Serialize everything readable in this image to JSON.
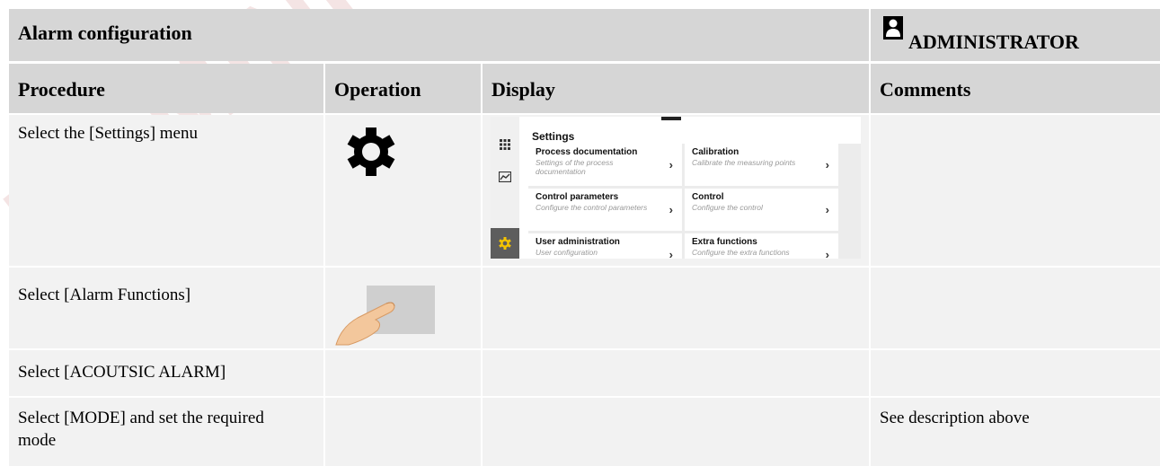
{
  "header": {
    "title": "Alarm configuration",
    "role": "ADMINISTRATOR"
  },
  "columns": [
    "Procedure",
    "Operation",
    "Display",
    "Comments"
  ],
  "rows": [
    {
      "procedure": "Select the [Settings] menu",
      "operation_icon": "gear-icon",
      "comment": ""
    },
    {
      "procedure": "Select [Alarm Functions]",
      "operation_icon": "finger-tap-icon",
      "comment": ""
    },
    {
      "procedure": "Select [ACOUTSIC ALARM]",
      "comment": ""
    },
    {
      "procedure": "Select [MODE] and set the required mode",
      "comment": "See description above"
    }
  ],
  "settings_screen": {
    "title": "Settings",
    "sidebar": [
      "apps-icon",
      "chart-icon",
      "gear-icon"
    ],
    "tiles": [
      {
        "title": "Process documentation",
        "subtitle": "Settings of the process documentation"
      },
      {
        "title": "Calibration",
        "subtitle": "Calibrate the measuring points"
      },
      {
        "title": "Control parameters",
        "subtitle": "Configure the control parameters"
      },
      {
        "title": "Control",
        "subtitle": "Configure the control"
      },
      {
        "title": "User administration",
        "subtitle": "User configuration"
      },
      {
        "title": "Extra functions",
        "subtitle": "Configure the extra functions"
      }
    ]
  },
  "watermark": "DOMINIC",
  "colors": {
    "header_bg": "#d6d6d6",
    "body_bg": "#f2f2f2",
    "accent": "#f5c400"
  }
}
